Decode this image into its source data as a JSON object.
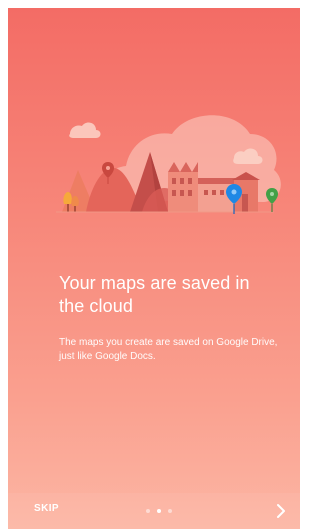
{
  "onboarding": {
    "title": "Your maps are saved in the cloud",
    "description": "The maps you create are saved on Google Drive, just like Google Docs."
  },
  "navigation": {
    "skip_label": "SKIP",
    "page_count": 3,
    "current_page_index": 1,
    "next_icon": "chevron-right-icon"
  },
  "illustration": {
    "icon": "cloud-landscape-illustration",
    "pins": [
      {
        "name": "red-map-pin-icon",
        "color": "#c9483f"
      },
      {
        "name": "blue-map-pin-icon",
        "color": "#1e88e5"
      },
      {
        "name": "green-map-pin-icon",
        "color": "#43a047"
      }
    ]
  },
  "colors": {
    "gradient_top": "#f36c65",
    "gradient_bottom": "#fcb6a4",
    "text": "#ffffff"
  }
}
